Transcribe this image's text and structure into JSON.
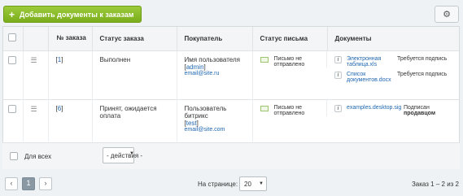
{
  "toolbar": {
    "add_label": "Добавить документы к заказам",
    "add_icon": "plus-icon",
    "settings_icon": "gear-icon"
  },
  "table": {
    "headers": {
      "number": "№ заказа",
      "status": "Статус заказа",
      "buyer": "Покупатель",
      "mail_status": "Статус письма",
      "documents": "Документы"
    },
    "rows": [
      {
        "order_open": "[",
        "order_num": "1",
        "order_close": "]",
        "status": "Выполнен",
        "buyer_name": "Имя пользователя",
        "buyer_login_open": "[",
        "buyer_login": "admin",
        "buyer_login_close": "]",
        "buyer_email": "email@site.ru",
        "mail_status": "Письмо не отправлено",
        "docs": [
          {
            "name": "Электронная таблица.xls",
            "state": "Требуется подпись",
            "state_bold": ""
          },
          {
            "name": "Список документов.docx",
            "state": "Требуется подпись",
            "state_bold": ""
          }
        ]
      },
      {
        "order_open": "[",
        "order_num": "6",
        "order_close": "]",
        "status": "Принят, ожидается оплата",
        "buyer_name": "Пользователь битрикс",
        "buyer_login_open": "[",
        "buyer_login": "test",
        "buyer_login_close": "]",
        "buyer_email": "email@site.com",
        "mail_status": "Письмо не отправлено",
        "docs": [
          {
            "name": "examples.desktop.sig",
            "state": "Подписан",
            "state_bold": "продавцом"
          }
        ]
      }
    ]
  },
  "footer": {
    "for_all": "Для всех",
    "action_value": "- действия -"
  },
  "pager": {
    "prev": "‹",
    "current": "1",
    "next": "›",
    "per_page_label": "На странице:",
    "per_page_value": "20",
    "total": "Заказ 1 – 2 из 2"
  },
  "colors": {
    "accent_green": "#86b826",
    "link": "#2067b0",
    "header_bg": "#f3f5f6"
  }
}
